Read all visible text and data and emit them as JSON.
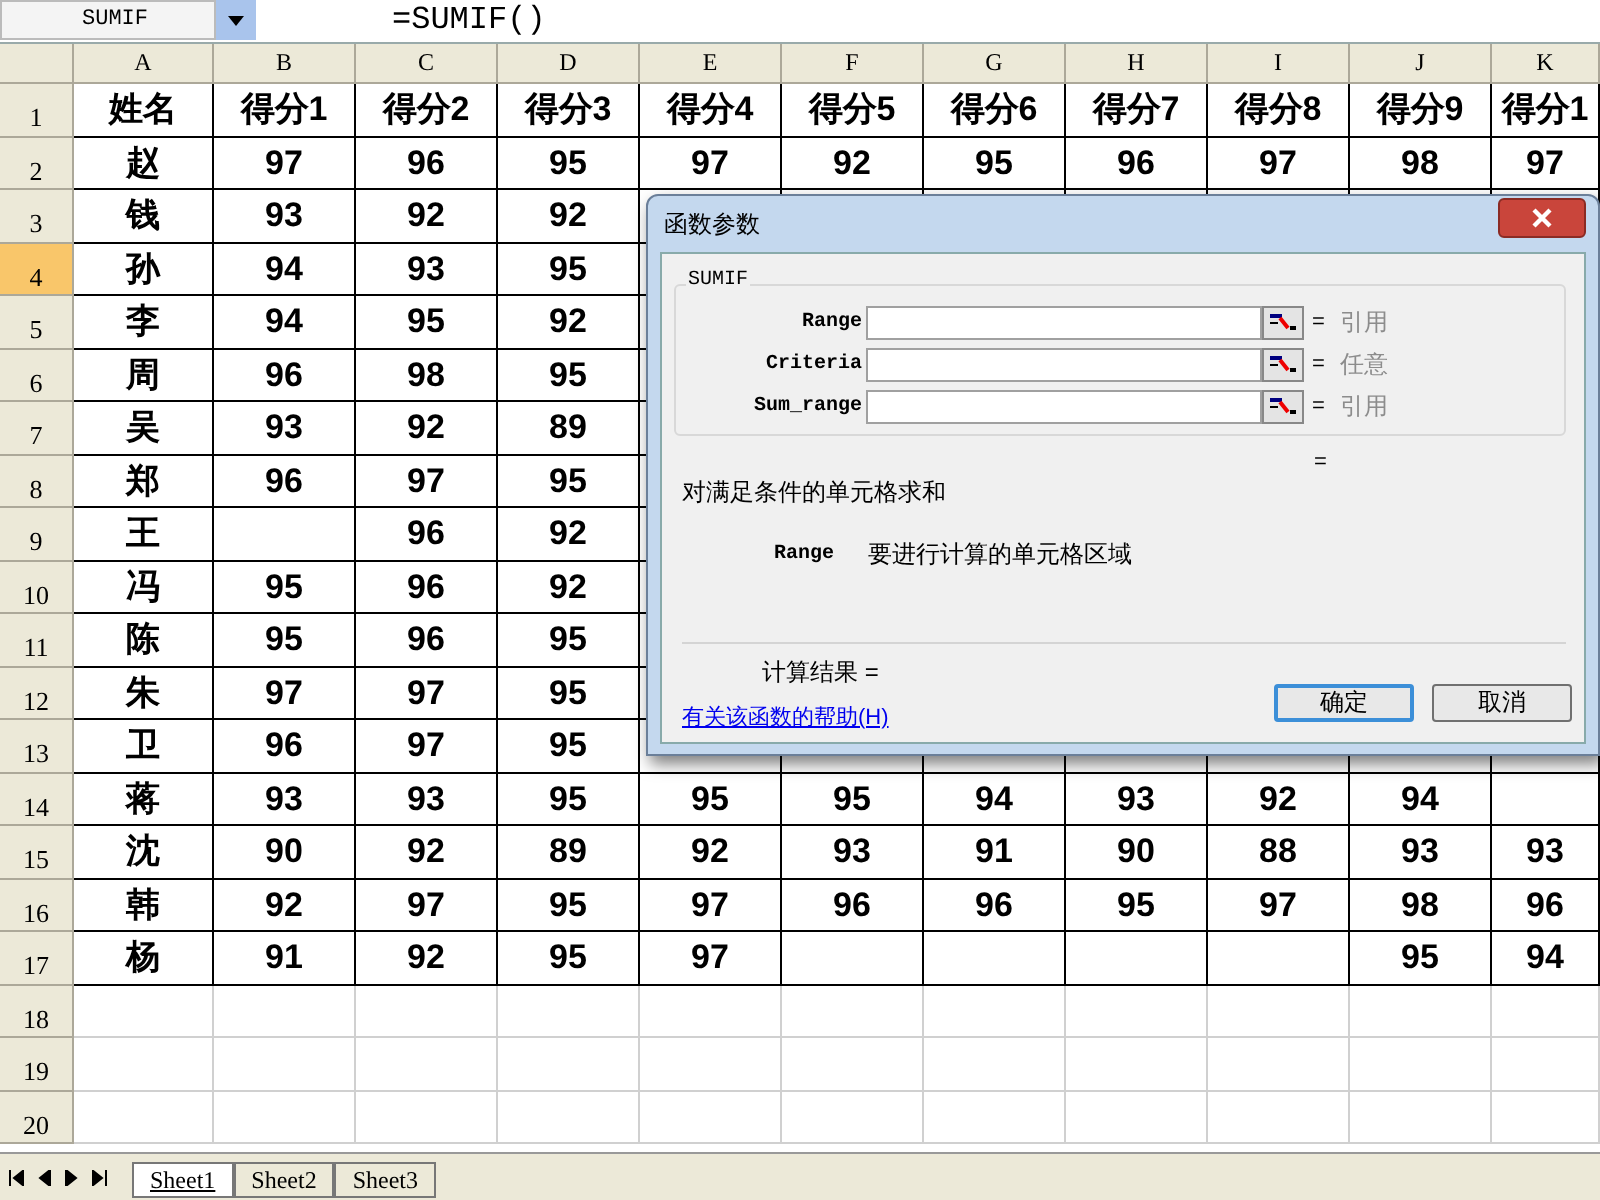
{
  "name_box": "SUMIF",
  "formula": "=SUMIF()",
  "columns": [
    "A",
    "B",
    "C",
    "D",
    "E",
    "F",
    "G",
    "H",
    "I",
    "J",
    "K"
  ],
  "rows": [
    {
      "number": "1",
      "selected": false,
      "cells": [
        "姓名",
        "得分1",
        "得分2",
        "得分3",
        "得分4",
        "得分5",
        "得分6",
        "得分7",
        "得分8",
        "得分9",
        "得分1"
      ]
    },
    {
      "number": "2",
      "selected": false,
      "cells": [
        "赵",
        "97",
        "96",
        "95",
        "97",
        "92",
        "95",
        "96",
        "97",
        "98",
        "97"
      ]
    },
    {
      "number": "3",
      "selected": false,
      "cells": [
        "钱",
        "93",
        "92",
        "92"
      ]
    },
    {
      "number": "4",
      "selected": true,
      "cells": [
        "孙",
        "94",
        "93",
        "95"
      ]
    },
    {
      "number": "5",
      "selected": false,
      "cells": [
        "李",
        "94",
        "95",
        "92"
      ]
    },
    {
      "number": "6",
      "selected": false,
      "cells": [
        "周",
        "96",
        "98",
        "95"
      ]
    },
    {
      "number": "7",
      "selected": false,
      "cells": [
        "吴",
        "93",
        "92",
        "89"
      ]
    },
    {
      "number": "8",
      "selected": false,
      "cells": [
        "郑",
        "96",
        "97",
        "95"
      ]
    },
    {
      "number": "9",
      "selected": false,
      "cells": [
        "王",
        null,
        "96",
        "92"
      ]
    },
    {
      "number": "10",
      "selected": false,
      "cells": [
        "冯",
        "95",
        "96",
        "92"
      ]
    },
    {
      "number": "11",
      "selected": false,
      "cells": [
        "陈",
        "95",
        "96",
        "95"
      ]
    },
    {
      "number": "12",
      "selected": false,
      "cells": [
        "朱",
        "97",
        "97",
        "95"
      ]
    },
    {
      "number": "13",
      "selected": false,
      "cells": [
        "卫",
        "96",
        "97",
        "95"
      ]
    },
    {
      "number": "14",
      "selected": false,
      "cells": [
        "蒋",
        "93",
        "93",
        "95",
        "95",
        "95",
        "94",
        "93",
        "92",
        "94",
        null
      ]
    },
    {
      "number": "15",
      "selected": false,
      "cells": [
        "沈",
        "90",
        "92",
        "89",
        "92",
        "93",
        "91",
        "90",
        "88",
        "93",
        "93"
      ]
    },
    {
      "number": "16",
      "selected": false,
      "cells": [
        "韩",
        "92",
        "97",
        "95",
        "97",
        "96",
        "96",
        "95",
        "97",
        "98",
        "96"
      ]
    },
    {
      "number": "17",
      "selected": false,
      "cells": [
        "杨",
        "91",
        "92",
        "95",
        "97",
        null,
        null,
        null,
        null,
        "95",
        "94"
      ]
    },
    {
      "number": "18",
      "selected": false
    },
    {
      "number": "19",
      "selected": false
    },
    {
      "number": "20",
      "selected": false
    }
  ],
  "dialog": {
    "title": "函数参数",
    "section": "SUMIF",
    "params": [
      {
        "label": "Range",
        "hint": "引用"
      },
      {
        "label": "Criteria",
        "hint": "任意"
      },
      {
        "label": "Sum_range",
        "hint": "引用"
      }
    ],
    "value_sign": "=",
    "description": "对满足条件的单元格求和",
    "arg_name": "Range",
    "arg_description": "要进行计算的单元格区域",
    "result_label": "计算结果 =",
    "help_link": "有关该函数的帮助(H)",
    "buttons": [
      {
        "label": "确定",
        "default": true
      },
      {
        "label": "取消",
        "default": false
      }
    ]
  },
  "sheet_tabs": [
    {
      "label": "Sheet1",
      "selected": true
    },
    {
      "label": "Sheet2",
      "selected": false
    },
    {
      "label": "Sheet3",
      "selected": false
    }
  ]
}
